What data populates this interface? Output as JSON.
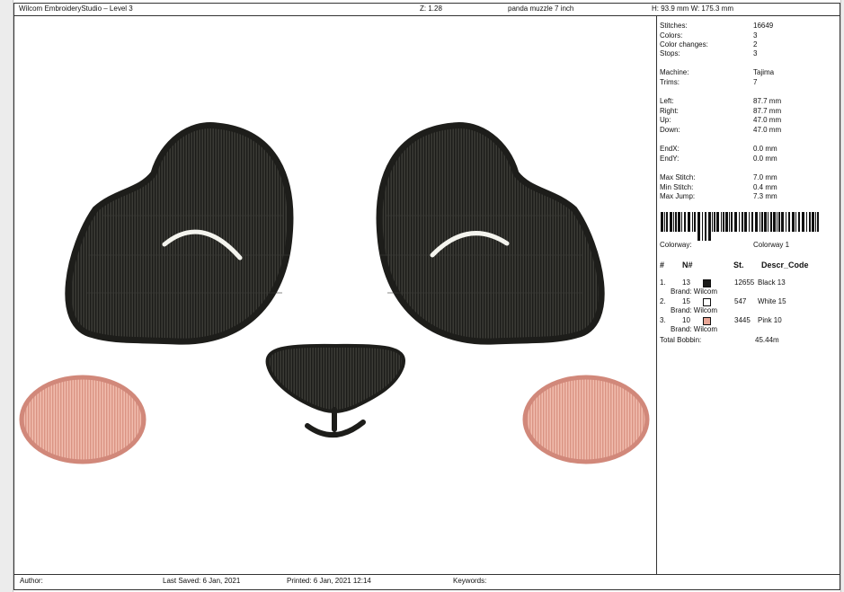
{
  "header": {
    "app_title": "Wilcom EmbroideryStudio – Level 3",
    "zoom": "Z: 1.28",
    "design_name": "panda muzzle 7 inch",
    "dimensions": "H: 93.9 mm  W: 175.3 mm"
  },
  "stats": [
    {
      "label": "Stitches:",
      "value": "16649"
    },
    {
      "label": "Colors:",
      "value": "3"
    },
    {
      "label": "Color changes:",
      "value": "2"
    },
    {
      "label": "Stops:",
      "value": "3"
    },
    {
      "label": "Machine:",
      "value": "Tajima"
    },
    {
      "label": "Trims:",
      "value": "7"
    },
    {
      "label": "Left:",
      "value": "87.7 mm"
    },
    {
      "label": "Right:",
      "value": "87.7 mm"
    },
    {
      "label": "Up:",
      "value": "47.0 mm"
    },
    {
      "label": "Down:",
      "value": "47.0 mm"
    },
    {
      "label": "EndX:",
      "value": "0.0 mm"
    },
    {
      "label": "EndY:",
      "value": "0.0 mm"
    },
    {
      "label": "Max Stitch:",
      "value": "7.0 mm"
    },
    {
      "label": "Min Stitch:",
      "value": "0.4 mm"
    },
    {
      "label": "Max Jump:",
      "value": "7.3 mm"
    }
  ],
  "colorway": {
    "label": "Colorway:",
    "value": "Colorway 1"
  },
  "color_table": {
    "headers": {
      "index": "#",
      "needle": "N#",
      "stitches": "St.",
      "descr_code": "Descr_Code"
    },
    "rows": [
      {
        "index": "1.",
        "needle": "13",
        "swatch": "#1c1c1a",
        "stitches": "12655",
        "descr": "Black 13",
        "brand": "Brand: Wilcom"
      },
      {
        "index": "2.",
        "needle": "15",
        "swatch": "#ffffff",
        "stitches": "547",
        "descr": "White 15",
        "brand": "Brand: Wilcom"
      },
      {
        "index": "3.",
        "needle": "10",
        "swatch": "#e8a595",
        "stitches": "3445",
        "descr": "Pink 10",
        "brand": "Brand: Wilcom"
      }
    ],
    "total_bobbin_label": "Total Bobbin:",
    "total_bobbin_value": "45.44m"
  },
  "footer": {
    "author_label": "Author:",
    "last_saved": "Last Saved:  6 Jan, 2021",
    "printed": "Printed:  6 Jan, 2021 12:14",
    "keywords_label": "Keywords:"
  },
  "colors": {
    "thread_black": "#2b2b27",
    "thread_black_dark": "#1a1a17",
    "thread_white": "#f4f4ee",
    "thread_pink": "#e7a797",
    "thread_pink_dark": "#d4887a"
  }
}
